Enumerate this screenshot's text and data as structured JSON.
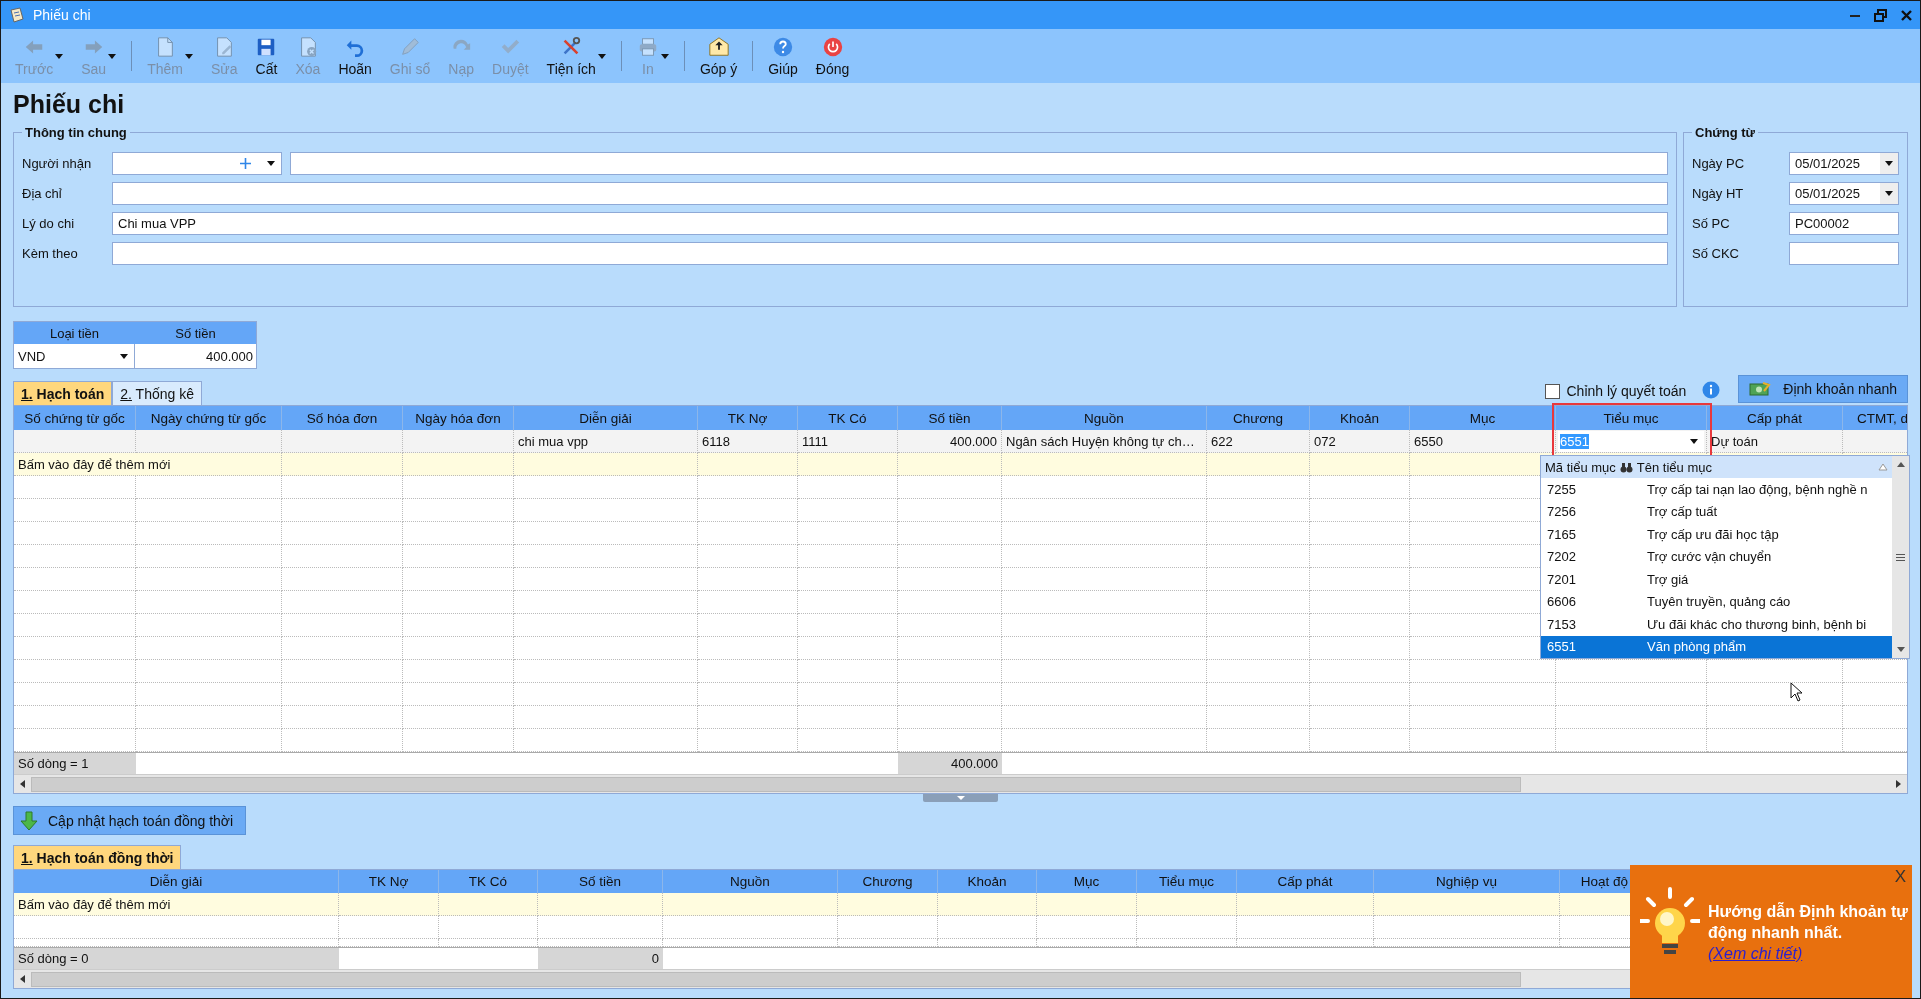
{
  "window": {
    "title": "Phiếu chi"
  },
  "toolbar": [
    [
      {
        "label": "Trước",
        "disabled": true,
        "dropdown": true
      },
      {
        "label": "Sau",
        "disabled": true,
        "dropdown": true
      }
    ],
    [
      {
        "label": "Thêm",
        "disabled": true,
        "dropdown": true
      },
      {
        "label": "Sửa",
        "disabled": true,
        "dropdown": false
      },
      {
        "label": "Cất",
        "disabled": false,
        "dropdown": false
      },
      {
        "label": "Xóa",
        "disabled": true,
        "dropdown": false
      },
      {
        "label": "Hoãn",
        "disabled": false,
        "dropdown": false
      },
      {
        "label": "Ghi sổ",
        "disabled": true,
        "dropdown": false
      },
      {
        "label": "Nạp",
        "disabled": true,
        "dropdown": false
      },
      {
        "label": "Duyệt",
        "disabled": true,
        "dropdown": false
      },
      {
        "label": "Tiện ích",
        "disabled": false,
        "dropdown": true
      }
    ],
    [
      {
        "label": "In",
        "disabled": true,
        "dropdown": true
      }
    ],
    [
      {
        "label": "Góp ý",
        "disabled": false,
        "dropdown": false
      }
    ],
    [
      {
        "label": "Giúp",
        "disabled": false,
        "dropdown": false
      },
      {
        "label": "Đóng",
        "disabled": false,
        "dropdown": false
      }
    ]
  ],
  "heading": "Phiếu chi",
  "general_info": {
    "title": "Thông tin chung",
    "fields": [
      {
        "label": "Người nhận",
        "kind": "combo_pair"
      },
      {
        "label": "Địa chỉ",
        "kind": "text"
      },
      {
        "label": "Lý do chi",
        "kind": "text",
        "value": "Chi mua VPP"
      },
      {
        "label": "Kèm theo",
        "kind": "text"
      }
    ]
  },
  "voucher": {
    "title": "Chứng từ",
    "fields": [
      {
        "label": "Ngày PC",
        "kind": "date",
        "value": "05/01/2025"
      },
      {
        "label": "Ngày HT",
        "kind": "date",
        "value": "05/01/2025"
      },
      {
        "label": "Số PC",
        "kind": "text",
        "value": "PC00002"
      },
      {
        "label": "Số CKC",
        "kind": "text"
      }
    ]
  },
  "currency": {
    "columns": [
      "Loại tiền",
      "Số tiền"
    ],
    "type": "VND",
    "amount": "400.000"
  },
  "tabs": [
    {
      "label": "1. Hạch toán",
      "selected": true
    },
    {
      "label": "2. Thống kê",
      "selected": false
    }
  ],
  "adjust_checkbox": {
    "label": "Chỉnh lý quyết toán",
    "checked": false
  },
  "quick_entry_button": "Định khoản nhanh",
  "grid": {
    "columns": [
      {
        "label": "Số chứng từ gốc",
        "total": false
      },
      {
        "label": "Ngày chứng từ gốc",
        "total": false
      },
      {
        "label": "Số hóa đơn",
        "total": false
      },
      {
        "label": "Ngày hóa đơn",
        "total": false
      },
      {
        "label": "Diễn giải",
        "total": false
      },
      {
        "label": "TK Nợ",
        "total": false
      },
      {
        "label": "TK Có",
        "total": false
      },
      {
        "label": "Số tiền",
        "total": true
      },
      {
        "label": "Nguồn",
        "total": false
      },
      {
        "label": "Chương",
        "total": false
      },
      {
        "label": "Khoản",
        "total": false
      },
      {
        "label": "Mục",
        "total": false
      },
      {
        "label": "Tiểu mục",
        "total": false
      },
      {
        "label": "Cấp phát",
        "total": false
      },
      {
        "label": "CTMT, d",
        "total": false
      }
    ],
    "rows": [
      {
        "cells": [
          {
            "kind": "empty"
          },
          {
            "kind": "empty"
          },
          {
            "kind": "empty"
          },
          {
            "kind": "empty"
          },
          {
            "kind": "text",
            "text": "chi mua vpp"
          },
          {
            "kind": "text",
            "text": "6118"
          },
          {
            "kind": "text",
            "text": "1111"
          },
          {
            "kind": "text",
            "text": "400.000"
          },
          {
            "kind": "text",
            "text": "Ngân sách Huyện không tự ch…"
          },
          {
            "kind": "text",
            "text": "622"
          },
          {
            "kind": "text",
            "text": "072"
          },
          {
            "kind": "text",
            "text": "6550"
          },
          {
            "kind": "editor",
            "value": "6551"
          },
          {
            "kind": "text",
            "text": "Dự toán"
          },
          {
            "kind": "empty"
          }
        ]
      }
    ],
    "add_row": "Bấm vào đây để thêm mới",
    "footer": {
      "count": "Số dòng = 1",
      "total": "400.000"
    }
  },
  "lookup": {
    "columns": [
      "Mã tiểu mục",
      "Tên tiểu mục"
    ],
    "items": [
      {
        "code": "7255",
        "name": "Trợ cấp tai nạn lao động, bệnh nghề n",
        "selected": false
      },
      {
        "code": "7256",
        "name": "Trợ cấp tuất",
        "selected": false
      },
      {
        "code": "7165",
        "name": "Trợ cấp ưu đãi học tập",
        "selected": false
      },
      {
        "code": "7202",
        "name": "Trợ cước vận chuyển",
        "selected": false
      },
      {
        "code": "7201",
        "name": "Trợ giá",
        "selected": false
      },
      {
        "code": "6606",
        "name": "Tuyên truyền, quảng cáo",
        "selected": false
      },
      {
        "code": "7153",
        "name": "Ưu đãi khác cho thương binh, bệnh bi",
        "selected": false
      },
      {
        "code": "6551",
        "name": "Văn phòng phẩm",
        "selected": true
      }
    ]
  },
  "update_button": "Cập nhật hạch toán đồng thời",
  "sub_tabs": [
    {
      "label": "1. Hạch toán đồng thời",
      "selected": true
    }
  ],
  "sub_grid": {
    "columns": [
      {
        "label": "Diễn giải",
        "total": false
      },
      {
        "label": "TK Nợ",
        "total": false
      },
      {
        "label": "TK Có",
        "total": false
      },
      {
        "label": "Số tiền",
        "total": true
      },
      {
        "label": "Nguồn",
        "total": false
      },
      {
        "label": "Chương",
        "total": false
      },
      {
        "label": "Khoản",
        "total": false
      },
      {
        "label": "Mục",
        "total": false
      },
      {
        "label": "Tiểu mục",
        "total": false
      },
      {
        "label": "Cấp phát",
        "total": false
      },
      {
        "label": "Nghiệp vụ",
        "total": false
      },
      {
        "label": "Hoạt độ",
        "total": false
      }
    ],
    "add_row": "Bấm vào đây để thêm mới",
    "footer": {
      "count": "Số dòng = 0",
      "total": "0"
    }
  },
  "tip": {
    "text": "Hướng dẫn Định khoản tự động nhanh nhất.",
    "link": "(Xem chi tiết)",
    "close": "X"
  }
}
